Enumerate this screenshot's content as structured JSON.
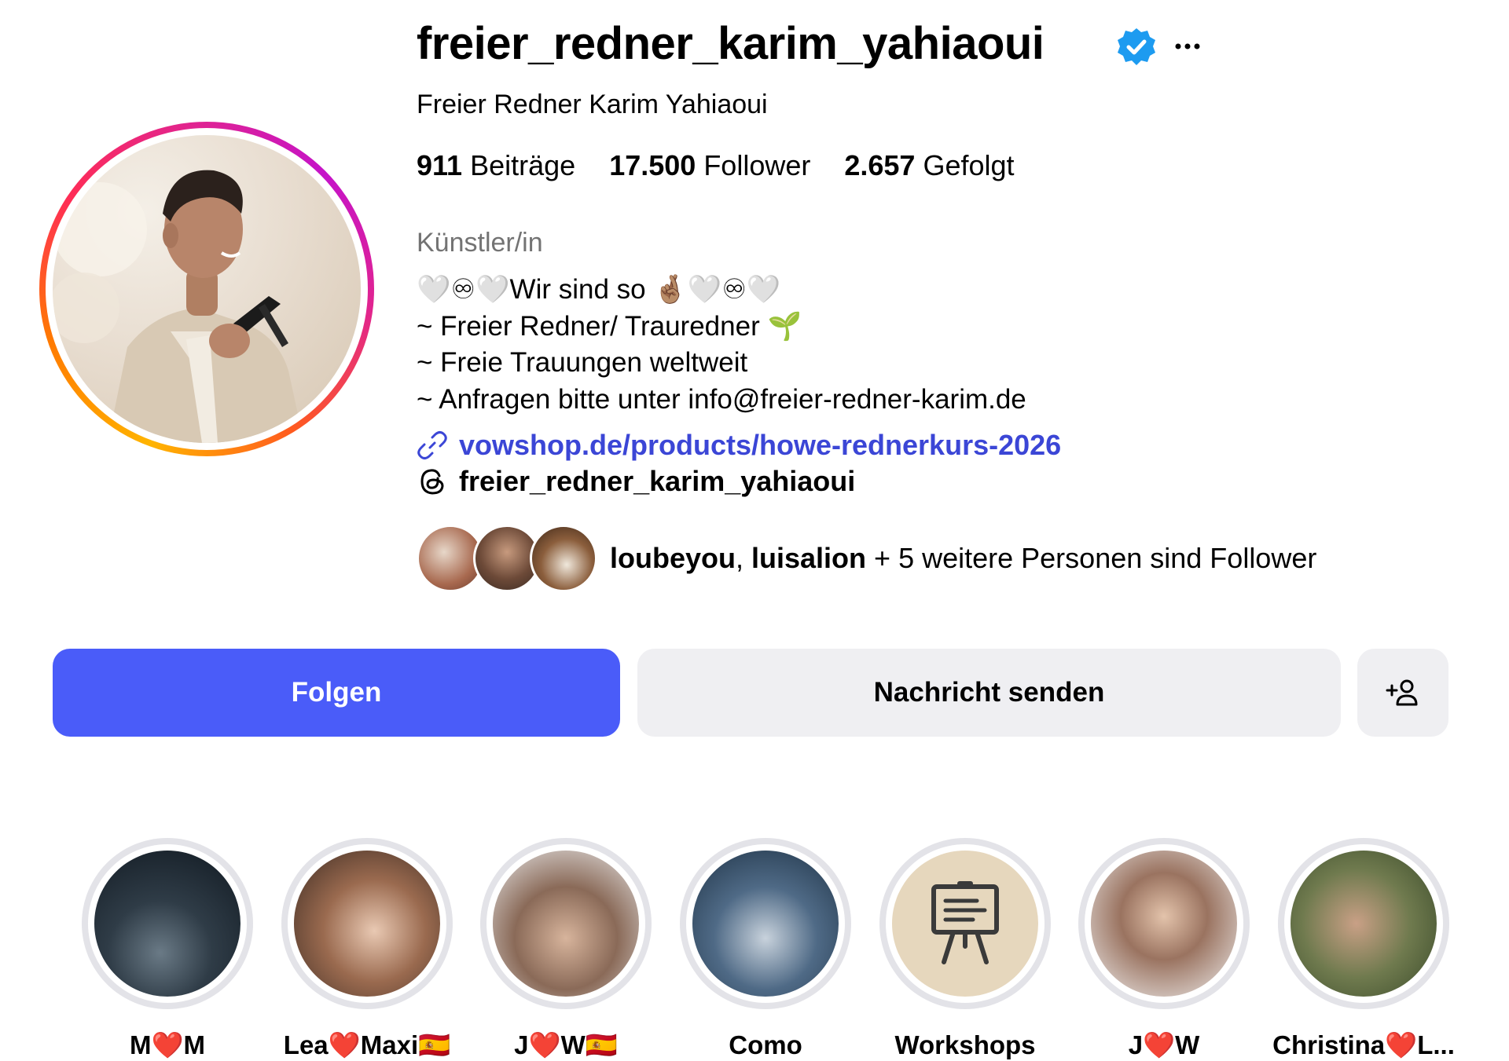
{
  "profile": {
    "username": "freier_redner_karim_yahiaoui",
    "display_name": "Freier Redner Karim Yahiaoui",
    "verified_icon": "verified-badge-icon",
    "more_icon": "more-options-icon",
    "stats": {
      "posts_count": "911",
      "posts_label": "Beiträge",
      "followers_count": "17.500",
      "followers_label": "Follower",
      "following_count": "2.657",
      "following_label": "Gefolgt"
    },
    "category": "Künstler/in",
    "bio": [
      "🤍♾🤍Wir sind so 🤞🏽🤍♾🤍",
      "~ Freier Redner/ Trauredner 🌱",
      "~ Freie Trauungen weltweit",
      "~ Anfragen bitte unter info@freier-redner-karim.de"
    ],
    "link": "vowshop.de/products/howe-rednerkurs-2026",
    "threads_handle": "freier_redner_karim_yahiaoui",
    "followed_by": {
      "names": [
        "loubeyou",
        "luisalion"
      ],
      "separator": ", ",
      "rest": " + 5 weitere Personen sind Follower"
    }
  },
  "actions": {
    "follow_label": "Folgen",
    "message_label": "Nachricht senden",
    "suggest_icon": "add-person-icon"
  },
  "highlights": [
    {
      "label": "M❤️M"
    },
    {
      "label": "Lea❤️Maxi🇪🇸"
    },
    {
      "label": "J❤️W🇪🇸"
    },
    {
      "label": "Como"
    },
    {
      "label": "Workshops"
    },
    {
      "label": "J❤️W"
    },
    {
      "label": "Christina❤️L..."
    }
  ],
  "colors": {
    "accent": "#4a5cf9",
    "link": "#3b46d6",
    "verified": "#1d9bf0",
    "secondary_text": "#737373",
    "button_grey": "#efeff2"
  }
}
